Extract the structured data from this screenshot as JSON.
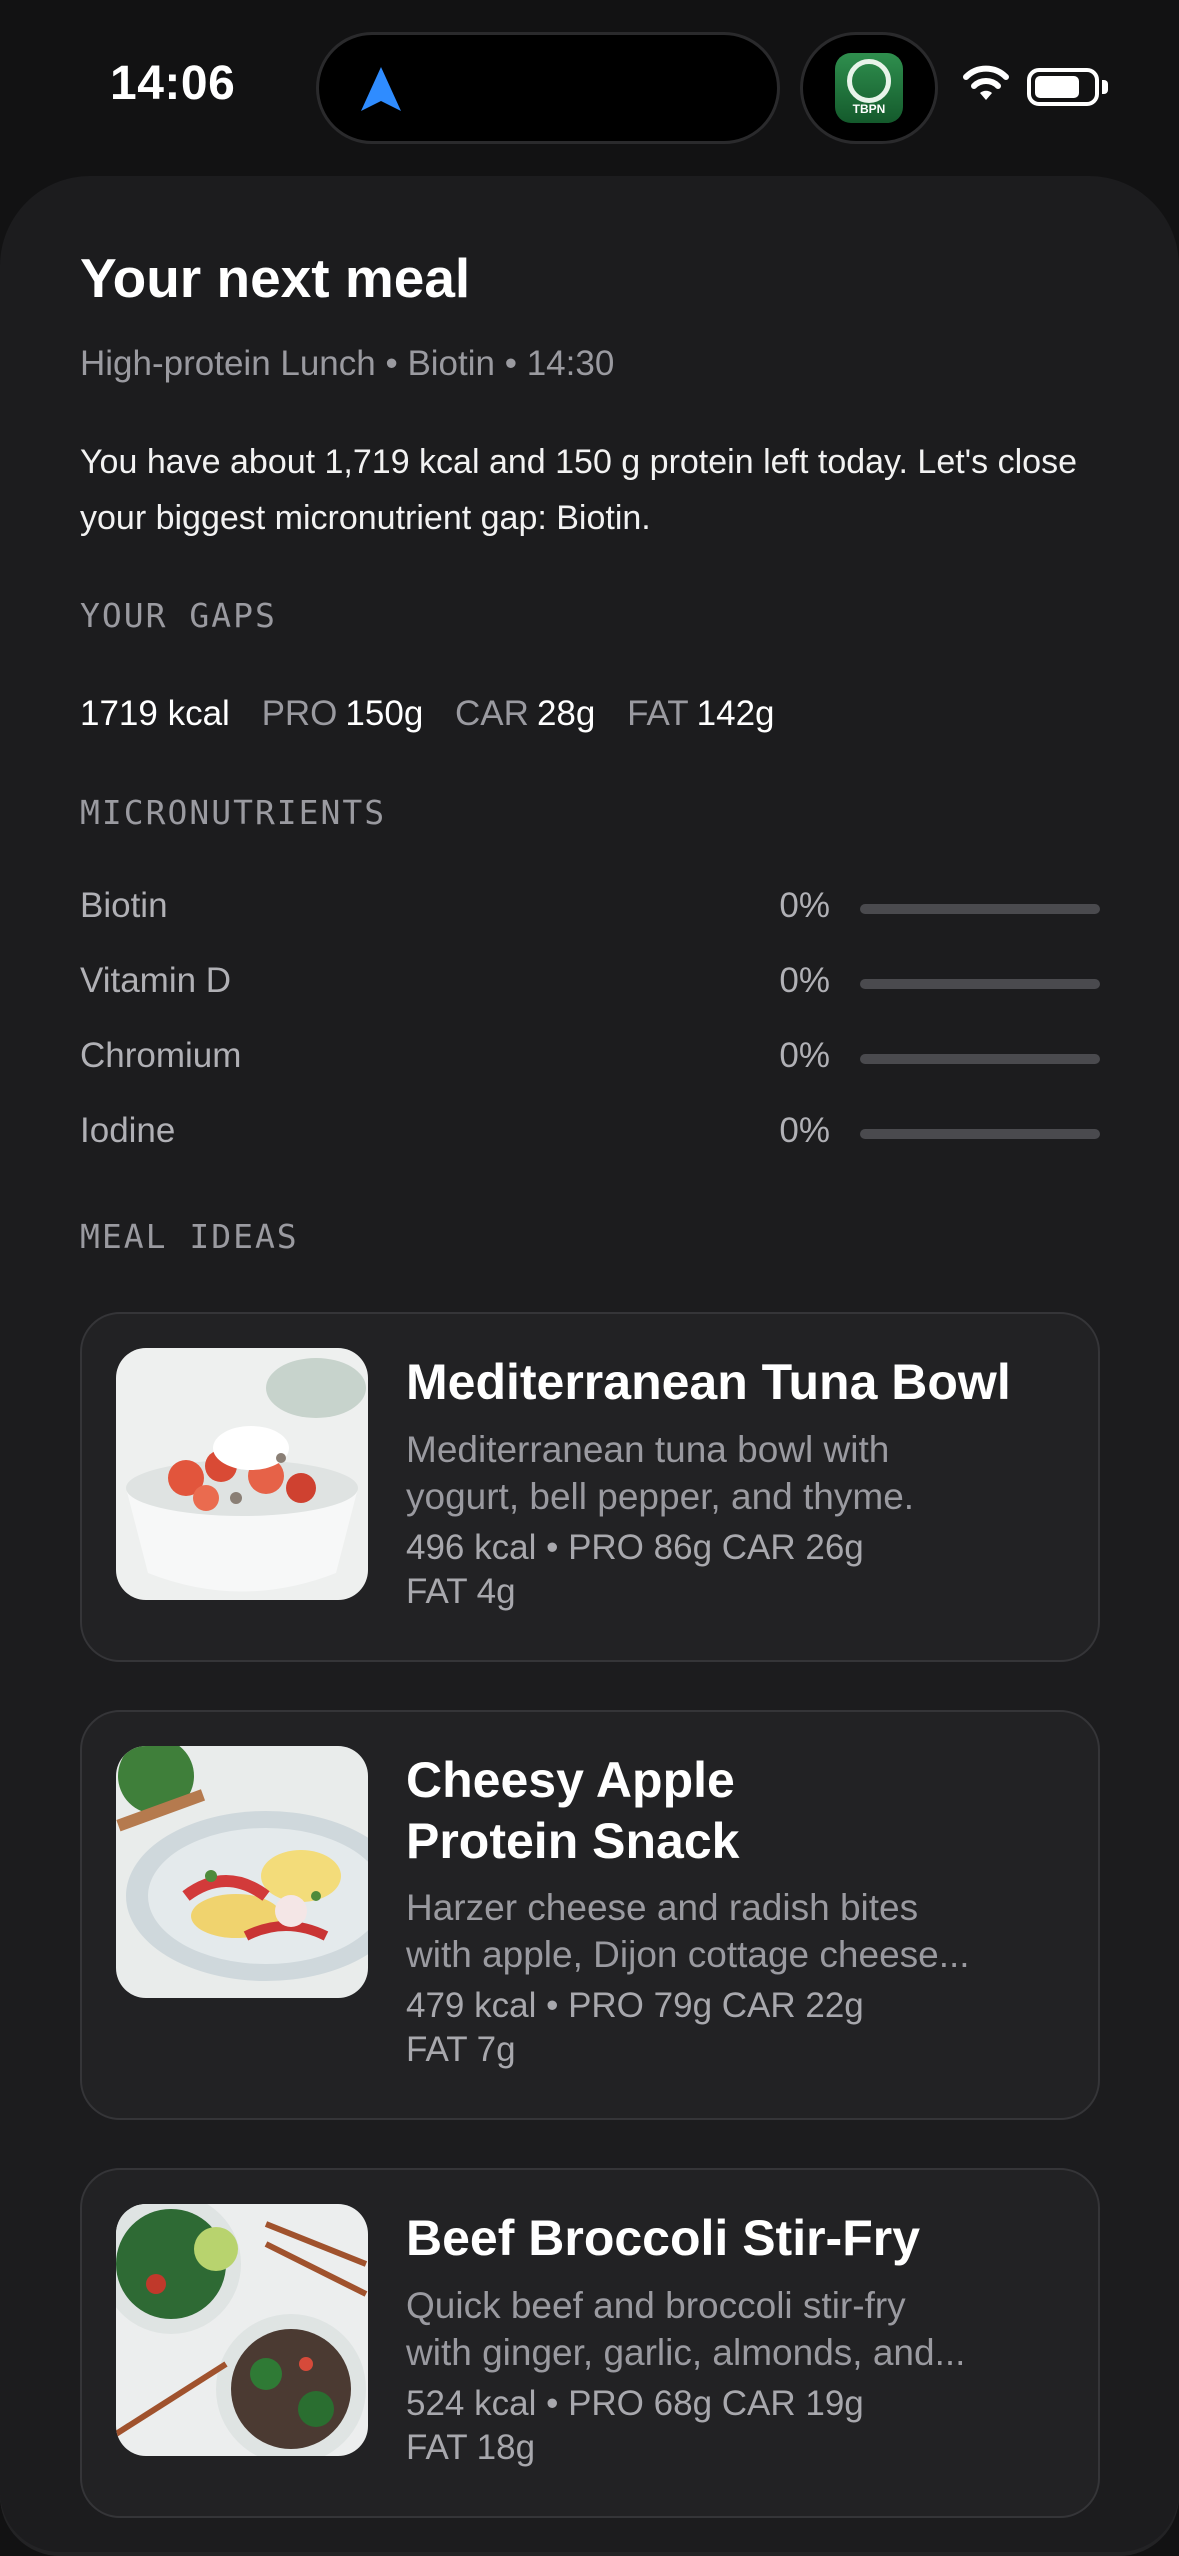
{
  "status_bar": {
    "time": "14:06",
    "app_icon_label": "TBPN",
    "icons": [
      "location-arrow-icon",
      "wifi-icon",
      "battery-icon"
    ]
  },
  "header": {
    "title": "Your next meal",
    "subtitle": "High-protein Lunch • Biotin • 14:30",
    "summary": "You have about 1,719 kcal and 150 g protein left today. Let's close your biggest micronutrient gap: Biotin."
  },
  "gaps": {
    "label": "YOUR GAPS",
    "kcal": "1719 kcal",
    "pro_key": "PRO",
    "pro_val": "150g",
    "car_key": "CAR",
    "car_val": "28g",
    "fat_key": "FAT",
    "fat_val": "142g"
  },
  "micronutrients": {
    "label": "MICRONUTRIENTS",
    "items": [
      {
        "name": "Biotin",
        "percent": "0%",
        "fill": 0
      },
      {
        "name": "Vitamin D",
        "percent": "0%",
        "fill": 0
      },
      {
        "name": "Chromium",
        "percent": "0%",
        "fill": 0
      },
      {
        "name": "Iodine",
        "percent": "0%",
        "fill": 0
      }
    ]
  },
  "meal_ideas": {
    "label": "MEAL IDEAS",
    "items": [
      {
        "title": "Mediterranean Tuna Bowl",
        "desc_line1": "Mediterranean tuna bowl with",
        "desc_line2": "yogurt, bell pepper, and thyme.",
        "macros_line1": "496 kcal • PRO 86g  CAR 26g",
        "macros_line2": "FAT 4g"
      },
      {
        "title_line1": "Cheesy Apple",
        "title_line2": "Protein Snack",
        "desc_line1": "Harzer cheese and radish bites",
        "desc_line2": "with apple, Dijon cottage cheese...",
        "macros_line1": "479 kcal • PRO 79g  CAR 22g",
        "macros_line2": "FAT 7g"
      },
      {
        "title": "Beef Broccoli Stir-Fry",
        "desc_line1": "Quick beef and broccoli stir-fry",
        "desc_line2": "with ginger, garlic, almonds, and...",
        "macros_line1": "524 kcal • PRO 68g  CAR 19g",
        "macros_line2": "FAT 18g"
      }
    ]
  }
}
